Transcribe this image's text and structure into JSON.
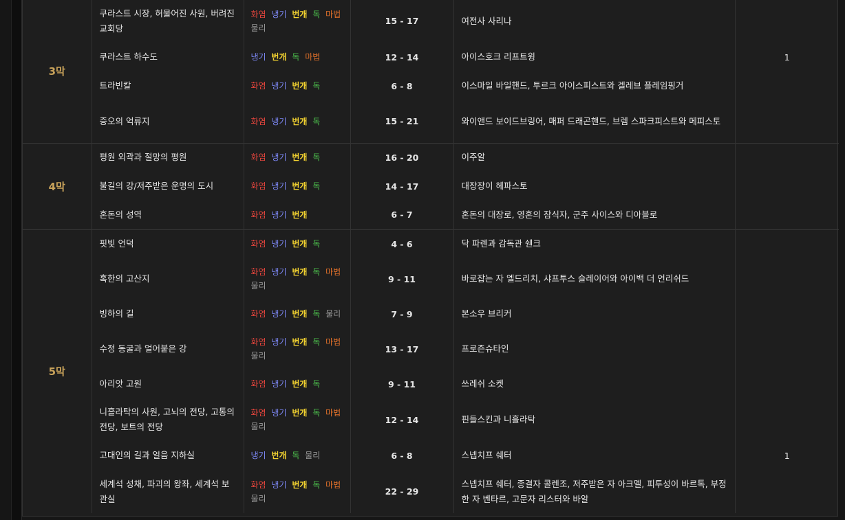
{
  "colors": {
    "fire": "#e0443c",
    "cold": "#7b86f2",
    "lightning": "#f2d230",
    "chaos": "#4cbf4c",
    "magic": "#e0702a",
    "physical": "#9a9a9a",
    "act_label": "#c8a25a"
  },
  "labels": {
    "fire": "화염",
    "cold": "냉기",
    "lightning": "번개",
    "chaos": "독",
    "magic": "마법",
    "physical": "물리"
  },
  "acts": [
    {
      "act": "3막",
      "rows": [
        {
          "location": "쿠라스트 시장, 허물어진 사원, 버려진 교회당",
          "res": [
            "fire",
            "cold",
            "lightning",
            "chaos",
            "magic",
            "physical"
          ],
          "level": "15 - 17",
          "boss": "여전사 사리나",
          "count": ""
        },
        {
          "location": "쿠라스트 하수도",
          "res": [
            "cold",
            "lightning",
            "chaos",
            "magic"
          ],
          "level": "12 - 14",
          "boss": "아이스호크 리프트윙",
          "count": "1"
        },
        {
          "location": "트라빈칼",
          "res": [
            "fire",
            "cold",
            "lightning",
            "chaos"
          ],
          "level": "6 - 8",
          "boss": "이스마일 바일핸드, 투르크 아이스피스트와 겔레브 플레임핑거",
          "count": ""
        },
        {
          "location": "증오의 억류지",
          "res": [
            "fire",
            "cold",
            "lightning",
            "chaos"
          ],
          "level": "15 - 21",
          "boss": "와이앤드 보이드브링어, 매퍼 드래곤핸드, 브렘 스파크피스트와 메피스토",
          "count": ""
        }
      ]
    },
    {
      "act": "4막",
      "rows": [
        {
          "location": "평원 외곽과 절망의 평원",
          "res": [
            "fire",
            "cold",
            "lightning",
            "chaos"
          ],
          "level": "16 - 20",
          "boss": "이주알",
          "count": ""
        },
        {
          "location": "불길의 강/저주받은 운명의 도시",
          "res": [
            "fire",
            "cold",
            "lightning",
            "chaos"
          ],
          "level": "14 - 17",
          "boss": "대장장이 헤파스토",
          "count": ""
        },
        {
          "location": "혼돈의 성역",
          "res": [
            "fire",
            "cold",
            "lightning"
          ],
          "level": "6 - 7",
          "boss": "혼돈의 대장로, 영혼의 잠식자, 군주 사이스와 디아블로",
          "count": ""
        }
      ]
    },
    {
      "act": "5막",
      "rows": [
        {
          "location": "핏빛 언덕",
          "res": [
            "fire",
            "cold",
            "lightning",
            "chaos"
          ],
          "level": "4 - 6",
          "boss": "닥 파렌과 감독관 쉔크",
          "count": ""
        },
        {
          "location": "혹한의 고산지",
          "res": [
            "fire",
            "cold",
            "lightning",
            "chaos",
            "magic",
            "physical"
          ],
          "level": "9 - 11",
          "boss": "바로잡는 자 엘드리치, 샤프투스 슬레이어와 아이백 더 언리쉬드",
          "count": ""
        },
        {
          "location": "빙하의 길",
          "res": [
            "fire",
            "cold",
            "lightning",
            "chaos",
            "physical"
          ],
          "level": "7 - 9",
          "boss": "본소우 브리커",
          "count": ""
        },
        {
          "location": "수정 동굴과 얼어붙은 강",
          "res": [
            "fire",
            "cold",
            "lightning",
            "chaos",
            "magic",
            "physical"
          ],
          "level": "13 - 17",
          "boss": "프로즌슈타인",
          "count": ""
        },
        {
          "location": "아리앗 고원",
          "res": [
            "fire",
            "cold",
            "lightning",
            "chaos"
          ],
          "level": "9 - 11",
          "boss": "쓰레쉬 소켓",
          "count": ""
        },
        {
          "location": "니흘라탁의 사원, 고뇌의 전당, 고통의 전당, 보트의 전당",
          "res": [
            "fire",
            "cold",
            "lightning",
            "chaos",
            "magic",
            "physical"
          ],
          "level": "12 - 14",
          "boss": "핀들스킨과 니흘라탁",
          "count": ""
        },
        {
          "location": "고대인의 길과 얼음 지하실",
          "res": [
            "cold",
            "lightning",
            "chaos",
            "physical"
          ],
          "level": "6 - 8",
          "boss": "스넵치프 쉐터",
          "count": "1"
        },
        {
          "location": "세계석 성채, 파괴의 왕좌, 세계석 보관실",
          "res": [
            "fire",
            "cold",
            "lightning",
            "chaos",
            "magic",
            "physical"
          ],
          "level": "22 - 29",
          "boss": "스넵치프 쉐터, 종결자 콜렌조, 저주받은 자 아크멜, 피투성이 바르톡, 부정한 자 벤타르, 고문자 리스터와 바알",
          "count": ""
        }
      ]
    }
  ]
}
